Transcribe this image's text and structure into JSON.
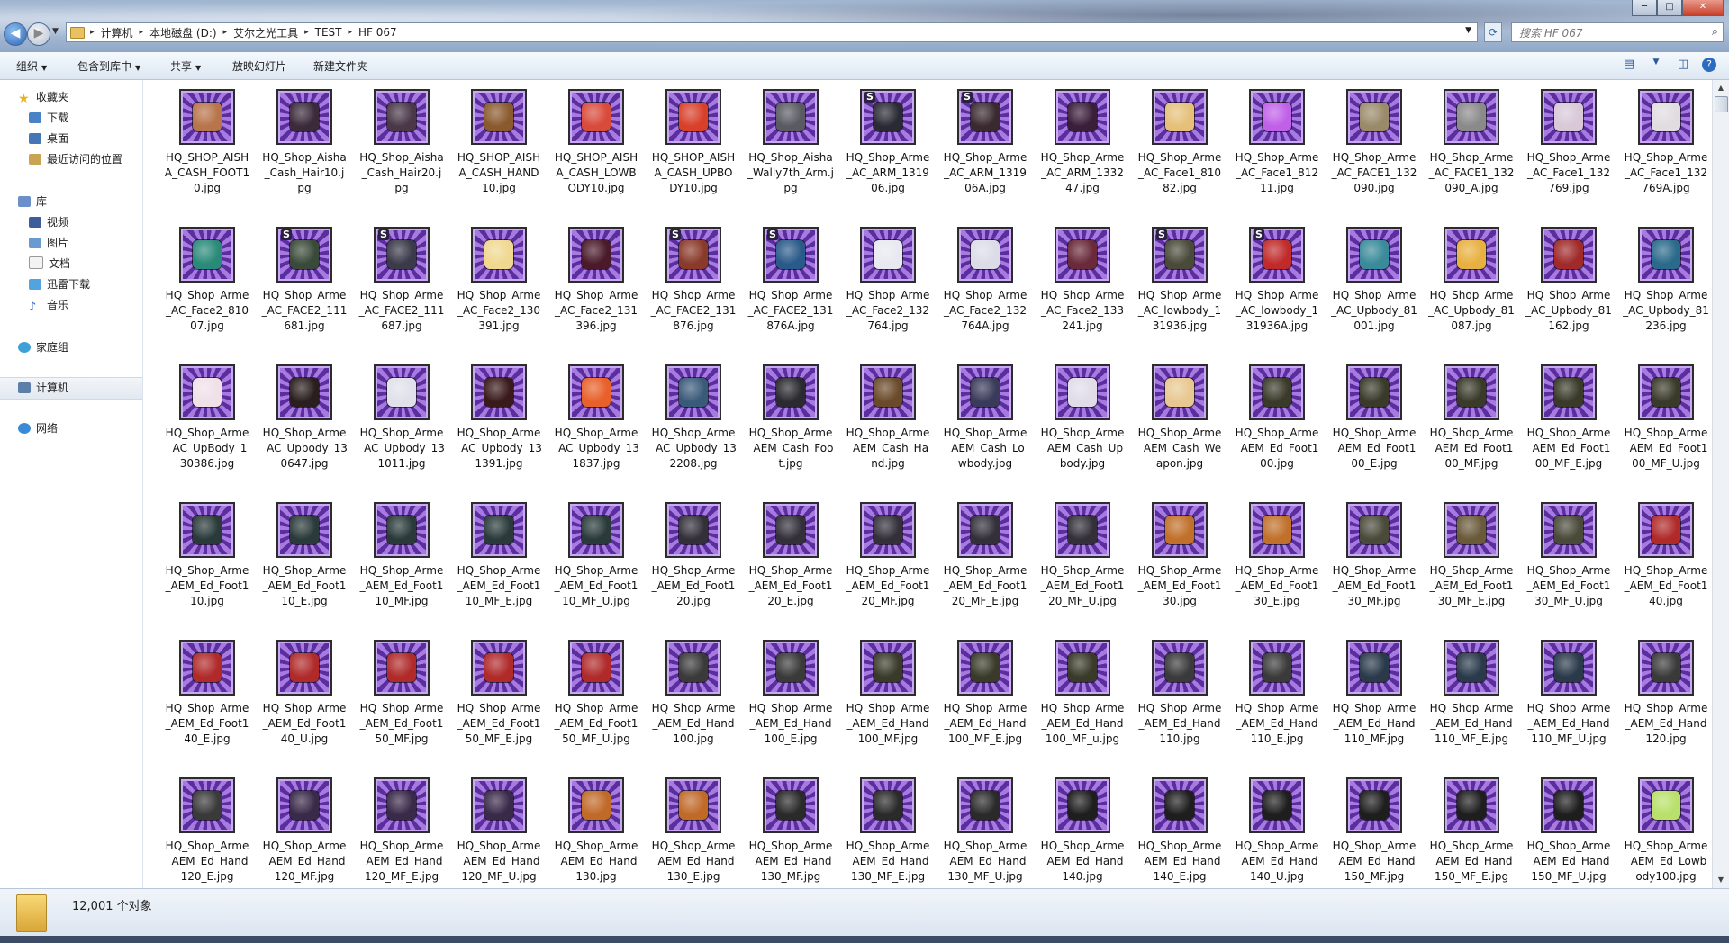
{
  "window": {
    "minimize_label": "─",
    "maximize_label": "□",
    "close_label": "✕"
  },
  "nav": {
    "back_label": "◀",
    "forward_label": "▶",
    "dropdown_label": "▼"
  },
  "address": {
    "crumbs": [
      "计算机",
      "本地磁盘 (D:)",
      "艾尔之光工具",
      "TEST",
      "HF 067"
    ],
    "separator": "▸",
    "dropdown_label": "▼"
  },
  "refresh_label": "⟳",
  "search": {
    "placeholder": "搜索 HF 067",
    "icon": "search-icon"
  },
  "toolbar": {
    "organize": "组织",
    "include_library": "包含到库中",
    "share": "共享",
    "slideshow": "放映幻灯片",
    "new_folder": "新建文件夹",
    "caret": "▼",
    "view_icon": "▤",
    "view_caret": "▼",
    "preview_icon": "◫",
    "help_icon": "?"
  },
  "sidebar": {
    "favorites": {
      "label": "收藏夹",
      "items": [
        "下载",
        "桌面",
        "最近访问的位置"
      ]
    },
    "libraries": {
      "label": "库",
      "items": [
        "视频",
        "图片",
        "文档",
        "迅雷下载",
        "音乐"
      ]
    },
    "homegroup": "家庭组",
    "computer": "计算机",
    "network": "网络"
  },
  "files": [
    {
      "name": "HQ_SHOP_AISHA_CASH_FOOT10.jpg",
      "s": false,
      "c": "#b8744a"
    },
    {
      "name": "HQ_Shop_Aisha_Cash_Hair10.jpg",
      "s": false,
      "c": "#3b2a3a"
    },
    {
      "name": "HQ_Shop_Aisha_Cash_Hair20.jpg",
      "s": false,
      "c": "#4a3848"
    },
    {
      "name": "HQ_SHOP_AISHA_CASH_HAND10.jpg",
      "s": false,
      "c": "#8a5a2e"
    },
    {
      "name": "HQ_SHOP_AISHA_CASH_LOWBODY10.jpg",
      "s": false,
      "c": "#d84a3a"
    },
    {
      "name": "HQ_SHOP_AISHA_CASH_UPBODY10.jpg",
      "s": false,
      "c": "#d8402a"
    },
    {
      "name": "HQ_Shop_Aisha_Wally7th_Arm.jpg",
      "s": false,
      "c": "#5a5a62"
    },
    {
      "name": "HQ_Shop_Arme_AC_ARM_131906.jpg",
      "s": true,
      "c": "#2a2a34"
    },
    {
      "name": "HQ_Shop_Arme_AC_ARM_131906A.jpg",
      "s": true,
      "c": "#3a2a30"
    },
    {
      "name": "HQ_Shop_Arme_AC_ARM_133247.jpg",
      "s": false,
      "c": "#3a1e3a"
    },
    {
      "name": "HQ_Shop_Arme_AC_Face1_81082.jpg",
      "s": false,
      "c": "#e6c07a"
    },
    {
      "name": "HQ_Shop_Arme_AC_Face1_81211.jpg",
      "s": false,
      "c": "#c060e8"
    },
    {
      "name": "HQ_Shop_Arme_AC_FACE1_132090.jpg",
      "s": false,
      "c": "#9a8a6a"
    },
    {
      "name": "HQ_Shop_Arme_AC_FACE1_132090_A.jpg",
      "s": false,
      "c": "#8a8a8a"
    },
    {
      "name": "HQ_Shop_Arme_AC_Face1_132769.jpg",
      "s": false,
      "c": "#d8c8d8"
    },
    {
      "name": "HQ_Shop_Arme_AC_Face1_132769A.jpg",
      "s": false,
      "c": "#e0dce0"
    },
    {
      "name": "HQ_Shop_Arme_AC_Face2_81007.jpg",
      "s": false,
      "c": "#2a8a7a"
    },
    {
      "name": "HQ_Shop_Arme_AC_FACE2_111681.jpg",
      "s": true,
      "c": "#3a4a3a"
    },
    {
      "name": "HQ_Shop_Arme_AC_FACE2_111687.jpg",
      "s": true,
      "c": "#3a3a4a"
    },
    {
      "name": "HQ_Shop_Arme_AC_Face2_130391.jpg",
      "s": false,
      "c": "#f0d890"
    },
    {
      "name": "HQ_Shop_Arme_AC_Face2_131396.jpg",
      "s": false,
      "c": "#4a1a2a"
    },
    {
      "name": "HQ_Shop_Arme_AC_FACE2_131876.jpg",
      "s": true,
      "c": "#8a3a2a"
    },
    {
      "name": "HQ_Shop_Arme_AC_FACE2_131876A.jpg",
      "s": true,
      "c": "#2a5a8a"
    },
    {
      "name": "HQ_Shop_Arme_AC_Face2_132764.jpg",
      "s": false,
      "c": "#e8e8f0"
    },
    {
      "name": "HQ_Shop_Arme_AC_Face2_132764A.jpg",
      "s": false,
      "c": "#dcdce8"
    },
    {
      "name": "HQ_Shop_Arme_AC_Face2_133241.jpg",
      "s": false,
      "c": "#6a2a3a"
    },
    {
      "name": "HQ_Shop_Arme_AC_lowbody_131936.jpg",
      "s": true,
      "c": "#4a4a3a"
    },
    {
      "name": "HQ_Shop_Arme_AC_lowbody_131936A.jpg",
      "s": true,
      "c": "#c02a2a"
    },
    {
      "name": "HQ_Shop_Arme_AC_Upbody_81001.jpg",
      "s": false,
      "c": "#3a8a9a"
    },
    {
      "name": "HQ_Shop_Arme_AC_Upbody_81087.jpg",
      "s": false,
      "c": "#e8b040"
    },
    {
      "name": "HQ_Shop_Arme_AC_Upbody_81162.jpg",
      "s": false,
      "c": "#a02a2a"
    },
    {
      "name": "HQ_Shop_Arme_AC_Upbody_81236.jpg",
      "s": false,
      "c": "#2a6a8a"
    },
    {
      "name": "HQ_Shop_Arme_AC_UpBody_130386.jpg",
      "s": false,
      "c": "#f0e0e8"
    },
    {
      "name": "HQ_Shop_Arme_AC_Upbody_130647.jpg",
      "s": false,
      "c": "#2a1e1e"
    },
    {
      "name": "HQ_Shop_Arme_AC_Upbody_131011.jpg",
      "s": false,
      "c": "#e0e0ea"
    },
    {
      "name": "HQ_Shop_Arme_AC_Upbody_131391.jpg",
      "s": false,
      "c": "#3a1a1a"
    },
    {
      "name": "HQ_Shop_Arme_AC_Upbody_131837.jpg",
      "s": false,
      "c": "#e8602a"
    },
    {
      "name": "HQ_Shop_Arme_AC_Upbody_132208.jpg",
      "s": false,
      "c": "#3a5a7a"
    },
    {
      "name": "HQ_Shop_Arme_AEM_Cash_Foot.jpg",
      "s": false,
      "c": "#2a2a30"
    },
    {
      "name": "HQ_Shop_Arme_AEM_Cash_Hand.jpg",
      "s": false,
      "c": "#6a4a2a"
    },
    {
      "name": "HQ_Shop_Arme_AEM_Cash_Lowbody.jpg",
      "s": false,
      "c": "#3a3a5a"
    },
    {
      "name": "HQ_Shop_Arme_AEM_Cash_Upbody.jpg",
      "s": false,
      "c": "#e0dce8"
    },
    {
      "name": "HQ_Shop_Arme_AEM_Cash_Weapon.jpg",
      "s": false,
      "c": "#e8c890"
    },
    {
      "name": "HQ_Shop_Arme_AEM_Ed_Foot100.jpg",
      "s": false,
      "c": "#3a3a2a"
    },
    {
      "name": "HQ_Shop_Arme_AEM_Ed_Foot100_E.jpg",
      "s": false,
      "c": "#3a3a2a"
    },
    {
      "name": "HQ_Shop_Arme_AEM_Ed_Foot100_MF.jpg",
      "s": false,
      "c": "#3a3a2a"
    },
    {
      "name": "HQ_Shop_Arme_AEM_Ed_Foot100_MF_E.jpg",
      "s": false,
      "c": "#3a3a2a"
    },
    {
      "name": "HQ_Shop_Arme_AEM_Ed_Foot100_MF_U.jpg",
      "s": false,
      "c": "#3a3a2a"
    },
    {
      "name": "HQ_Shop_Arme_AEM_Ed_Foot110.jpg",
      "s": false,
      "c": "#2a3a3a"
    },
    {
      "name": "HQ_Shop_Arme_AEM_Ed_Foot110_E.jpg",
      "s": false,
      "c": "#2a3a3a"
    },
    {
      "name": "HQ_Shop_Arme_AEM_Ed_Foot110_MF.jpg",
      "s": false,
      "c": "#2a3a3a"
    },
    {
      "name": "HQ_Shop_Arme_AEM_Ed_Foot110_MF_E.jpg",
      "s": false,
      "c": "#2a3a3a"
    },
    {
      "name": "HQ_Shop_Arme_AEM_Ed_Foot110_MF_U.jpg",
      "s": false,
      "c": "#2a3a3a"
    },
    {
      "name": "HQ_Shop_Arme_AEM_Ed_Foot120.jpg",
      "s": false,
      "c": "#33303a"
    },
    {
      "name": "HQ_Shop_Arme_AEM_Ed_Foot120_E.jpg",
      "s": false,
      "c": "#33303a"
    },
    {
      "name": "HQ_Shop_Arme_AEM_Ed_Foot120_MF.jpg",
      "s": false,
      "c": "#33303a"
    },
    {
      "name": "HQ_Shop_Arme_AEM_Ed_Foot120_MF_E.jpg",
      "s": false,
      "c": "#33303a"
    },
    {
      "name": "HQ_Shop_Arme_AEM_Ed_Foot120_MF_U.jpg",
      "s": false,
      "c": "#33303a"
    },
    {
      "name": "HQ_Shop_Arme_AEM_Ed_Foot130.jpg",
      "s": false,
      "c": "#c0702a"
    },
    {
      "name": "HQ_Shop_Arme_AEM_Ed_Foot130_E.jpg",
      "s": false,
      "c": "#c0702a"
    },
    {
      "name": "HQ_Shop_Arme_AEM_Ed_Foot130_MF.jpg",
      "s": false,
      "c": "#4a4a3a"
    },
    {
      "name": "HQ_Shop_Arme_AEM_Ed_Foot130_MF_E.jpg",
      "s": false,
      "c": "#6a5a3a"
    },
    {
      "name": "HQ_Shop_Arme_AEM_Ed_Foot130_MF_U.jpg",
      "s": false,
      "c": "#4a4a3a"
    },
    {
      "name": "HQ_Shop_Arme_AEM_Ed_Foot140.jpg",
      "s": false,
      "c": "#b02a2a"
    },
    {
      "name": "HQ_Shop_Arme_AEM_Ed_Foot140_E.jpg",
      "s": false,
      "c": "#b02a2a"
    },
    {
      "name": "HQ_Shop_Arme_AEM_Ed_Foot140_U.jpg",
      "s": false,
      "c": "#b02a2a"
    },
    {
      "name": "HQ_Shop_Arme_AEM_Ed_Foot150_MF.jpg",
      "s": false,
      "c": "#b02a2a"
    },
    {
      "name": "HQ_Shop_Arme_AEM_Ed_Foot150_MF_E.jpg",
      "s": false,
      "c": "#b02a2a"
    },
    {
      "name": "HQ_Shop_Arme_AEM_Ed_Foot150_MF_U.jpg",
      "s": false,
      "c": "#b02a2a"
    },
    {
      "name": "HQ_Shop_Arme_AEM_Ed_Hand100.jpg",
      "s": false,
      "c": "#3a3a3a"
    },
    {
      "name": "HQ_Shop_Arme_AEM_Ed_Hand100_E.jpg",
      "s": false,
      "c": "#3a3a3a"
    },
    {
      "name": "HQ_Shop_Arme_AEM_Ed_Hand100_MF.jpg",
      "s": false,
      "c": "#3a3a2a"
    },
    {
      "name": "HQ_Shop_Arme_AEM_Ed_Hand100_MF_E.jpg",
      "s": false,
      "c": "#3a3a2a"
    },
    {
      "name": "HQ_Shop_Arme_AEM_Ed_Hand100_MF_u.jpg",
      "s": false,
      "c": "#3a3a2a"
    },
    {
      "name": "HQ_Shop_Arme_AEM_Ed_Hand110.jpg",
      "s": false,
      "c": "#3a3a3a"
    },
    {
      "name": "HQ_Shop_Arme_AEM_Ed_Hand110_E.jpg",
      "s": false,
      "c": "#3a3a3a"
    },
    {
      "name": "HQ_Shop_Arme_AEM_Ed_Hand110_MF.jpg",
      "s": false,
      "c": "#2a3a4a"
    },
    {
      "name": "HQ_Shop_Arme_AEM_Ed_Hand110_MF_E.jpg",
      "s": false,
      "c": "#2a3a4a"
    },
    {
      "name": "HQ_Shop_Arme_AEM_Ed_Hand110_MF_U.jpg",
      "s": false,
      "c": "#2a3a4a"
    },
    {
      "name": "HQ_Shop_Arme_AEM_Ed_Hand120.jpg",
      "s": false,
      "c": "#3a3a3a"
    },
    {
      "name": "HQ_Shop_Arme_AEM_Ed_Hand120_E.jpg",
      "s": false,
      "c": "#3a3a3a"
    },
    {
      "name": "HQ_Shop_Arme_AEM_Ed_Hand120_MF.jpg",
      "s": false,
      "c": "#3a2a4a"
    },
    {
      "name": "HQ_Shop_Arme_AEM_Ed_Hand120_MF_E.jpg",
      "s": false,
      "c": "#3a2a4a"
    },
    {
      "name": "HQ_Shop_Arme_AEM_Ed_Hand120_MF_U.jpg",
      "s": false,
      "c": "#3a2a4a"
    },
    {
      "name": "HQ_Shop_Arme_AEM_Ed_Hand130.jpg",
      "s": false,
      "c": "#c06a2a"
    },
    {
      "name": "HQ_Shop_Arme_AEM_Ed_Hand130_E.jpg",
      "s": false,
      "c": "#c06a2a"
    },
    {
      "name": "HQ_Shop_Arme_AEM_Ed_Hand130_MF.jpg",
      "s": false,
      "c": "#2a2a2a"
    },
    {
      "name": "HQ_Shop_Arme_AEM_Ed_Hand130_MF_E.jpg",
      "s": false,
      "c": "#2a2a2a"
    },
    {
      "name": "HQ_Shop_Arme_AEM_Ed_Hand130_MF_U.jpg",
      "s": false,
      "c": "#2a2a2a"
    },
    {
      "name": "HQ_Shop_Arme_AEM_Ed_Hand140.jpg",
      "s": false,
      "c": "#1e1e1e"
    },
    {
      "name": "HQ_Shop_Arme_AEM_Ed_Hand140_E.jpg",
      "s": false,
      "c": "#1e1e1e"
    },
    {
      "name": "HQ_Shop_Arme_AEM_Ed_Hand140_U.jpg",
      "s": false,
      "c": "#1e1e1e"
    },
    {
      "name": "HQ_Shop_Arme_AEM_Ed_Hand150_MF.jpg",
      "s": false,
      "c": "#1e1e1e"
    },
    {
      "name": "HQ_Shop_Arme_AEM_Ed_Hand150_MF_E.jpg",
      "s": false,
      "c": "#1e1e1e"
    },
    {
      "name": "HQ_Shop_Arme_AEM_Ed_Hand150_MF_U.jpg",
      "s": false,
      "c": "#1e1e1e"
    },
    {
      "name": "HQ_Shop_Arme_AEM_Ed_Lowbody100.jpg",
      "s": false,
      "c": "#b8e06a"
    }
  ],
  "status": {
    "count": "12,001 个对象"
  },
  "scrollbar": {
    "up": "▲",
    "down": "▼"
  }
}
